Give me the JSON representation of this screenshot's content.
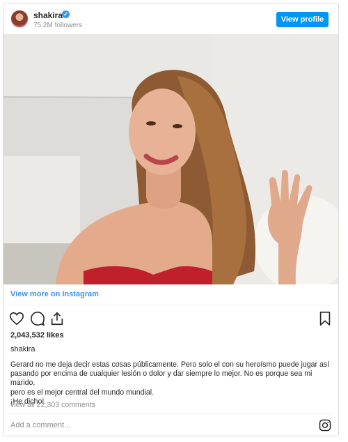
{
  "header": {
    "username": "shakira",
    "followers": "75.2M followers",
    "view_profile_label": "View profile"
  },
  "post": {
    "view_more_label": "View more on Instagram",
    "likes": "2,043,532 likes",
    "caption_user": "shakira",
    "caption_lines": [
      "Gerard no me deja decir estas cosas públicamente. Pero solo el con su heroísmo puede jugar así",
      "pasando por encima de cualquier lesión o dolor y dar siempre lo mejor. No es porque sea mi marido,",
      "pero es el mejor central del mundo mundial.",
      "¡He dicho!"
    ],
    "view_all_comments": "view all 22,303 comments"
  },
  "comment": {
    "placeholder": "Add a comment..."
  },
  "icons": {
    "like": "heart-icon",
    "comment": "comment-icon",
    "share": "share-icon",
    "save": "bookmark-icon",
    "instagram": "instagram-icon",
    "verified": "verified-badge-icon"
  },
  "colors": {
    "accent": "#0095f6",
    "link": "#3897f0",
    "text": "#262626",
    "muted": "#8e8e8e"
  }
}
